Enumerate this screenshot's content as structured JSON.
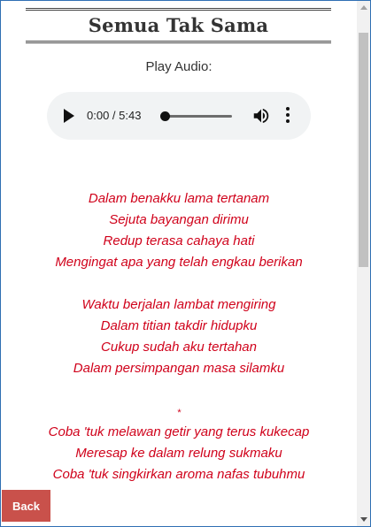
{
  "header": {
    "title": "Semua Tak Sama"
  },
  "audio": {
    "label": "Play Audio:",
    "time_display": "0:00 / 5:43",
    "progress_fraction": 0,
    "play_icon": "play-icon",
    "volume_icon": "volume-icon",
    "menu_icon": "more-vert-icon"
  },
  "lyrics": {
    "stanza1": [
      "Dalam benakku lama tertanam",
      "Sejuta bayangan dirimu",
      "Redup terasa cahaya hati",
      "Mengingat apa yang telah engkau berikan"
    ],
    "stanza2": [
      "Waktu berjalan lambat mengiring",
      "Dalam titian takdir hidupku",
      "Cukup sudah aku tertahan",
      "Dalam persimpangan masa silamku"
    ],
    "separator": "*",
    "stanza3": [
      "Coba 'tuk melawan getir yang terus kukecap",
      "Meresap ke dalam relung sukmaku",
      "Coba 'tuk singkirkan aroma nafas tubuhmu"
    ]
  },
  "footer": {
    "back_label": "Back"
  },
  "colors": {
    "lyrics": "#d0021b",
    "back_button": "#c9514b"
  }
}
